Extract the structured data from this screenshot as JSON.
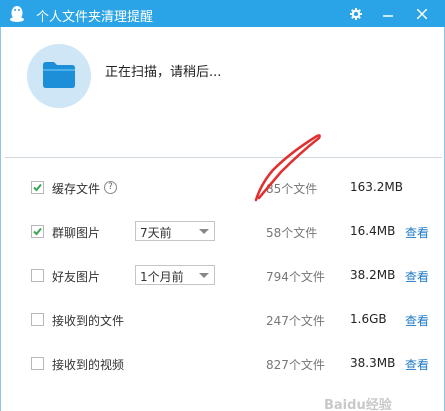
{
  "window": {
    "title": "个人文件夹清理提醒"
  },
  "colors": {
    "titlebar": "#2aa4e6",
    "link": "#1f79c6",
    "check": "#3aa655",
    "annotation": "#e03030"
  },
  "status": {
    "scan_text": "正在扫描，请稍后..."
  },
  "rows": [
    {
      "label": "缓存文件",
      "checked": true,
      "help": "?",
      "count": "85个文件",
      "size": "163.2MB",
      "view": ""
    },
    {
      "label": "群聊图片",
      "checked": true,
      "select": "7天前",
      "count": "58个文件",
      "size": "16.4MB",
      "view": "查看"
    },
    {
      "label": "好友图片",
      "checked": false,
      "select": "1个月前",
      "count": "794个文件",
      "size": "38.2MB",
      "view": "查看"
    },
    {
      "label": "接收到的文件",
      "checked": false,
      "count": "247个文件",
      "size": "1.6GB",
      "view": "查看"
    },
    {
      "label": "接收到的视频",
      "checked": false,
      "count": "827个文件",
      "size": "38.3MB",
      "view": "查看"
    }
  ],
  "watermark": "Baidu经验"
}
